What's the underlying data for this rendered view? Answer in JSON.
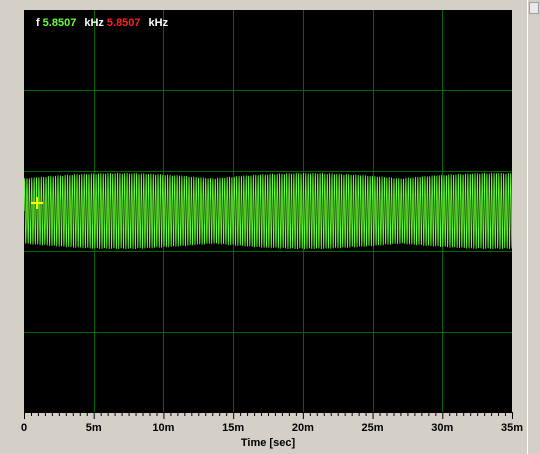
{
  "readout": {
    "frequency_label": "f",
    "value_1": "5.8507",
    "unit_1": "kHz",
    "value_2": "5.8507",
    "unit_2": "kHz"
  },
  "colors": {
    "plot_background": "#000000",
    "grid": "#006600",
    "signal": "#66ff33",
    "value_1": "#66ff33",
    "value_2": "#ff2020",
    "cursor": "#ffff00"
  },
  "chart_data": {
    "type": "line",
    "title": "",
    "xlabel": "Time [sec]",
    "ylabel": "",
    "xlim": [
      0,
      0.035
    ],
    "x_tick_labels": [
      "0",
      "5m",
      "10m",
      "15m",
      "20m",
      "25m",
      "30m",
      "35m"
    ],
    "x_ticks": [
      0,
      0.005,
      0.01,
      0.015,
      0.02,
      0.025,
      0.03,
      0.035
    ],
    "grid": true,
    "signal_frequency_hz": 5850.7,
    "series": [
      {
        "values_description_free": true,
        "x_start": 0,
        "x_end": 0.035,
        "amplitude_fraction_of_half_height": 0.19,
        "center_fraction_of_height": 0.5
      }
    ],
    "cursor": {
      "x": 0.0005
    }
  },
  "icons": {
    "cursor_marker": "crosshair-icon"
  }
}
